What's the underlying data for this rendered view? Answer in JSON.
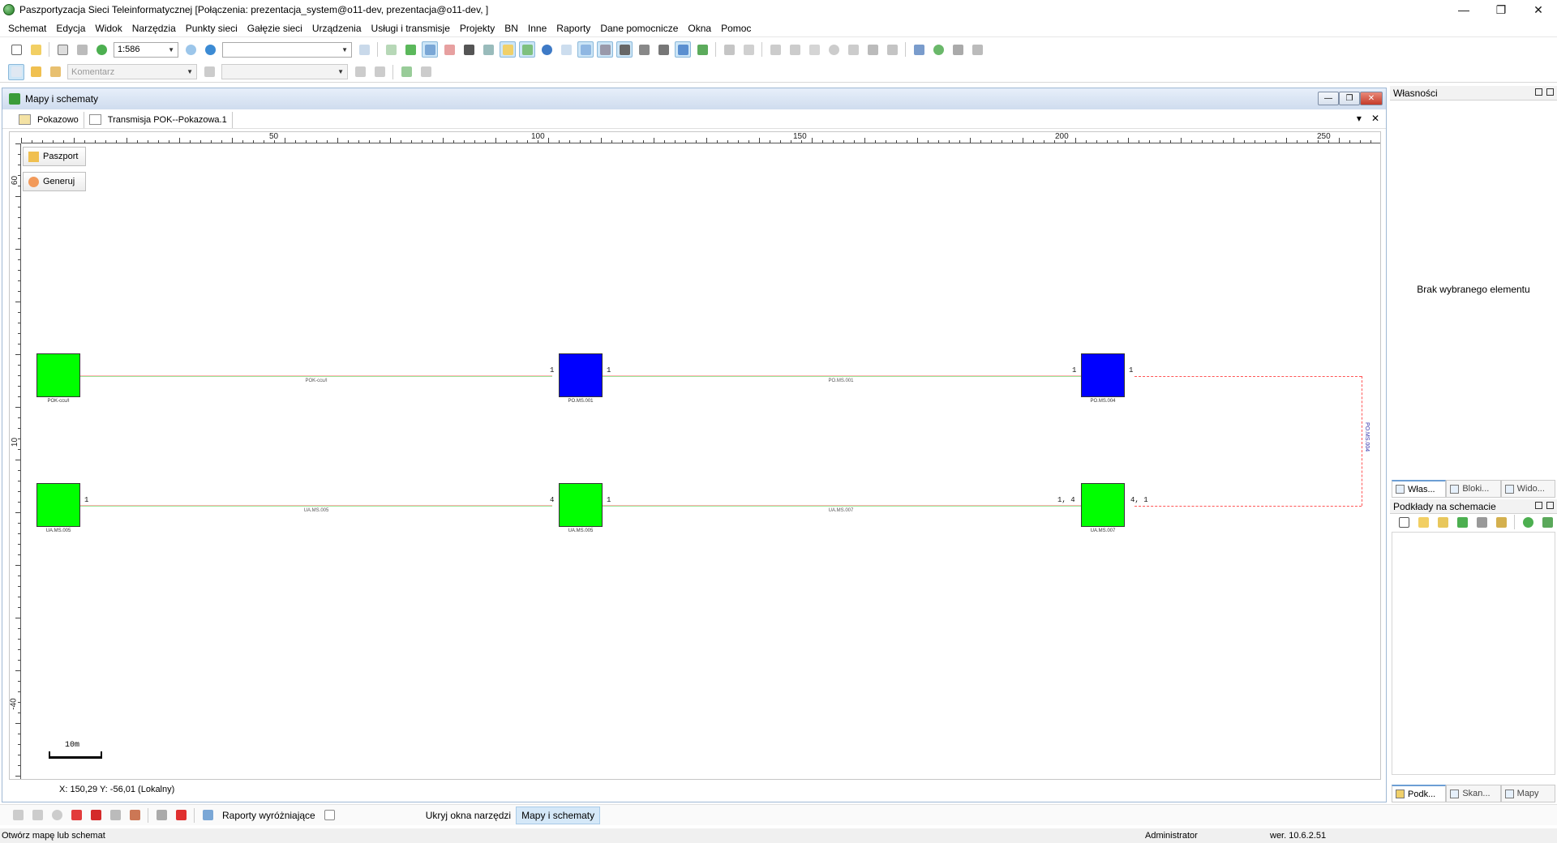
{
  "window": {
    "title": "Paszportyzacja Sieci Teleinformatycznej [Połączenia: prezentacja_system@o11-dev, prezentacja@o11-dev, ]",
    "minimize": "—",
    "maximize": "❐",
    "close": "✕"
  },
  "menu": [
    "Schemat",
    "Edycja",
    "Widok",
    "Narzędzia",
    "Punkty sieci",
    "Gałęzie sieci",
    "Urządzenia",
    "Usługi i transmisje",
    "Projekty",
    "BN",
    "Inne",
    "Raporty",
    "Dane pomocnicze",
    "Okna",
    "Pomoc"
  ],
  "toolbar": {
    "scale_value": "1:586",
    "search_value": "",
    "comment_placeholder": "Komentarz",
    "layer_value": ""
  },
  "child_window": {
    "title": "Mapy i schematy",
    "tabs": [
      "Pokazowo",
      "Transmisja POK--Pokazowa.1"
    ],
    "tab_close": "✕",
    "tab_menu": "▾"
  },
  "rulers": {
    "h_labels": [
      "50",
      "100",
      "150",
      "200",
      "250"
    ],
    "v_labels": [
      "60",
      "10",
      "-40"
    ]
  },
  "schematic_buttons": {
    "paszport": "Paszport",
    "generuj": "Generuj"
  },
  "nodes": [
    {
      "label": "POK-ccu/l",
      "color": "green"
    },
    {
      "label": "PO.MS.001",
      "color": "blue"
    },
    {
      "label": "PO.MS.004",
      "color": "blue"
    },
    {
      "label": "UA.MS.005",
      "color": "green"
    },
    {
      "label": "UA.MS.005",
      "color": "green"
    },
    {
      "label": "UA.MS.007",
      "color": "green"
    }
  ],
  "links": [
    {
      "label": "POK-ccu/l"
    },
    {
      "label": "PO.MS.001"
    },
    {
      "label": "UA.MS.005"
    },
    {
      "label": "UA.MS.007"
    },
    {
      "label": "PO.MS.004"
    }
  ],
  "ports": {
    "top_1": "1",
    "top_2": "1",
    "top_3": "1",
    "top_4": "1",
    "bot_1": "1",
    "bot_2": "4",
    "bot_3": "1",
    "bot_4": "1, 4",
    "bot_5": "4, 1"
  },
  "scalebar": {
    "label": "10m"
  },
  "coordinates": "X: 150,29  Y: -56,01 (Lokalny)",
  "right_panel": {
    "properties_title": "Własności",
    "empty_text": "Brak wybranego elementu",
    "tabs_top": [
      "Włas...",
      "Bloki...",
      "Wido..."
    ],
    "layers_title": "Podkłady na schemacie",
    "tabs_bottom": [
      "Podk...",
      "Skan...",
      "Mapy"
    ]
  },
  "bottombar": {
    "reports": "Raporty wyróżniające",
    "hide_tools": "Ukryj okna narzędzi",
    "maps": "Mapy i schematy"
  },
  "status": {
    "hint": "Otwórz mapę lub schemat",
    "user": "Administrator",
    "version": "wer. 10.6.2.51"
  },
  "colors": {
    "node_green": "#00ff00",
    "node_blue": "#0000ff",
    "dash_link": "#ff5555",
    "accent": "#6c9ed4"
  }
}
